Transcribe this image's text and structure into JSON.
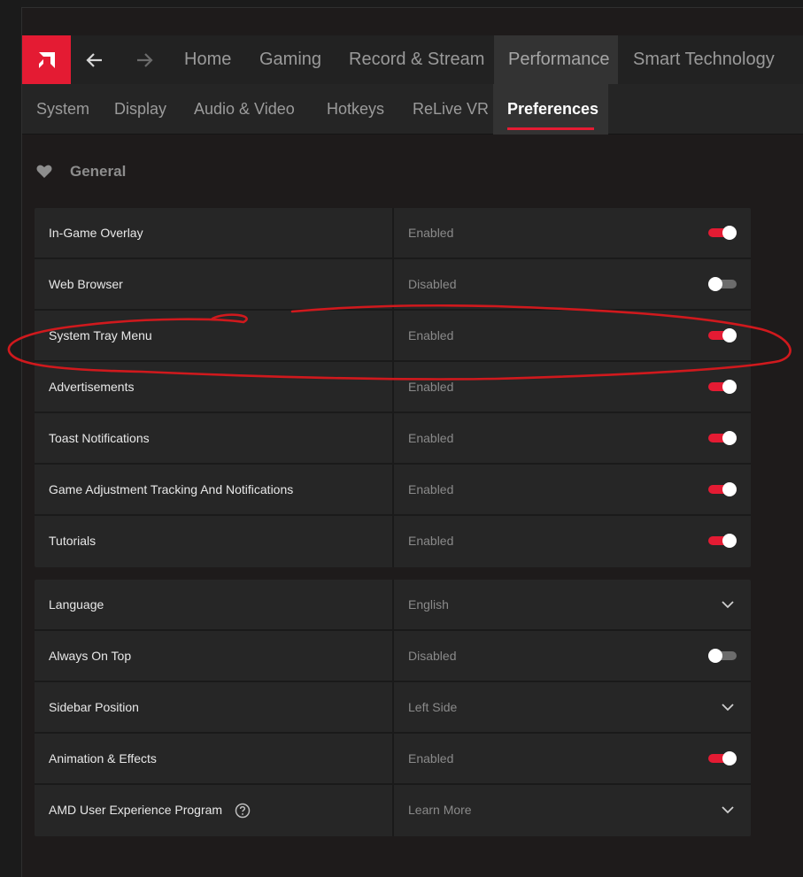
{
  "nav": {
    "back_icon": "arrow-left-icon",
    "forward_icon": "arrow-right-icon",
    "logo_icon": "amd-logo-icon",
    "tabs": [
      {
        "label": "Home"
      },
      {
        "label": "Gaming"
      },
      {
        "label": "Record & Stream"
      },
      {
        "label": "Performance"
      },
      {
        "label": "Smart Technology"
      }
    ],
    "active_tab": "Performance"
  },
  "subnav": {
    "tabs": [
      {
        "label": "System"
      },
      {
        "label": "Display"
      },
      {
        "label": "Audio & Video"
      },
      {
        "label": "Hotkeys"
      },
      {
        "label": "ReLive VR"
      },
      {
        "label": "Preferences"
      }
    ],
    "active_tab": "Preferences"
  },
  "section": {
    "title": "General",
    "icon": "heart-icon"
  },
  "general_settings": [
    {
      "label": "In-Game Overlay",
      "value": "Enabled",
      "control": "toggle",
      "on": true
    },
    {
      "label": "Web Browser",
      "value": "Disabled",
      "control": "toggle",
      "on": false
    },
    {
      "label": "System Tray Menu",
      "value": "Enabled",
      "control": "toggle",
      "on": true
    },
    {
      "label": "Advertisements",
      "value": "Enabled",
      "control": "toggle",
      "on": true
    },
    {
      "label": "Toast Notifications",
      "value": "Enabled",
      "control": "toggle",
      "on": true
    },
    {
      "label": "Game Adjustment Tracking And Notifications",
      "value": "Enabled",
      "control": "toggle",
      "on": true
    },
    {
      "label": "Tutorials",
      "value": "Enabled",
      "control": "toggle",
      "on": true
    }
  ],
  "other_settings": [
    {
      "label": "Language",
      "value": "English",
      "control": "dropdown"
    },
    {
      "label": "Always On Top",
      "value": "Disabled",
      "control": "toggle",
      "on": false
    },
    {
      "label": "Sidebar Position",
      "value": "Left Side",
      "control": "dropdown"
    },
    {
      "label": "Animation & Effects",
      "value": "Enabled",
      "control": "toggle",
      "on": true
    },
    {
      "label": "AMD User Experience Program",
      "value": "Learn More",
      "control": "dropdown",
      "help_icon": "question-circle-icon"
    }
  ],
  "colors": {
    "accent": "#e41b33",
    "annotation": "#d0191d",
    "background": "#1e1b1b"
  }
}
